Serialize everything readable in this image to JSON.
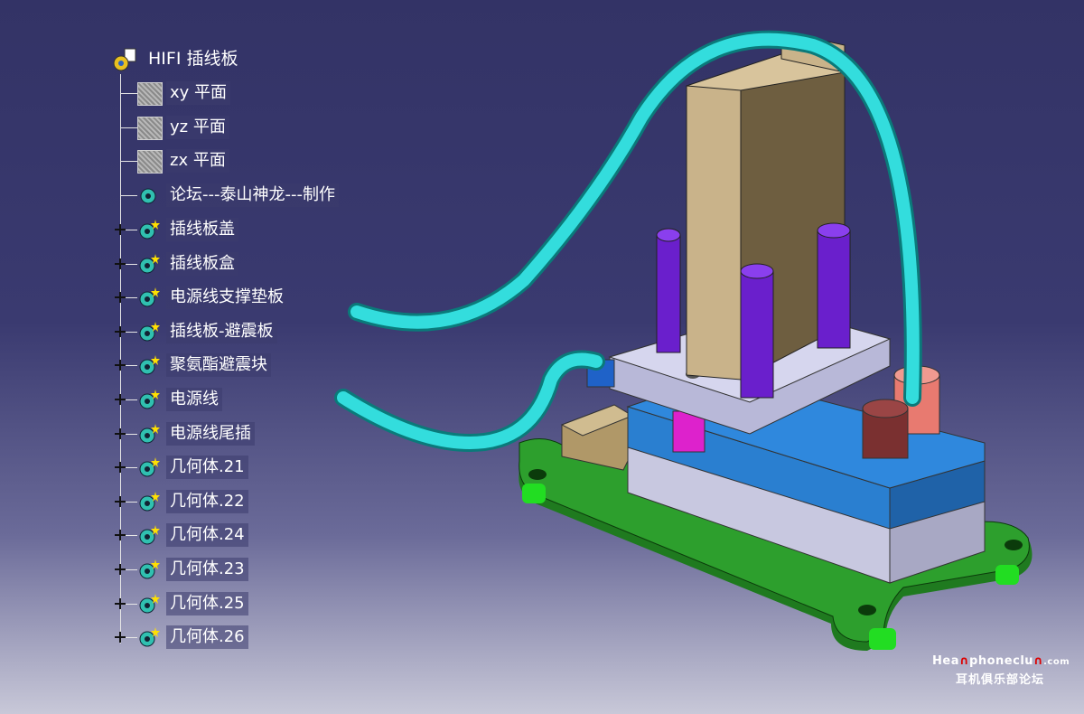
{
  "tree": {
    "root_label": "HIFI 插线板",
    "planes": [
      {
        "label": "xy 平面"
      },
      {
        "label": "yz 平面"
      },
      {
        "label": "zx 平面"
      }
    ],
    "credit_body": {
      "label": "论坛---泰山神龙---制作"
    },
    "bodies": [
      {
        "label": "插线板盖"
      },
      {
        "label": "插线板盒"
      },
      {
        "label": "电源线支撑垫板"
      },
      {
        "label": "插线板-避震板"
      },
      {
        "label": "聚氨酯避震块"
      },
      {
        "label": "电源线"
      },
      {
        "label": "电源线尾插"
      },
      {
        "label": "几何体.21"
      },
      {
        "label": "几何体.22"
      },
      {
        "label": "几何体.24"
      },
      {
        "label": "几何体.23"
      },
      {
        "label": "几何体.25"
      },
      {
        "label": "几何体.26"
      }
    ]
  },
  "watermark": {
    "site_prefix": "Hea",
    "site_middle": "phoneclu",
    "site_suffix": ".com",
    "forum_name": "耳机俱乐部论坛"
  },
  "colors": {
    "background_top": "#333366",
    "background_bottom": "#c8c8d8",
    "hose": "#33cccc",
    "block": "#c9b38a",
    "pillar": "#6a1fcc",
    "base_plate": "#2d8f2d",
    "box_top": "#2a7fd0",
    "box_side": "#c8c8e0"
  }
}
